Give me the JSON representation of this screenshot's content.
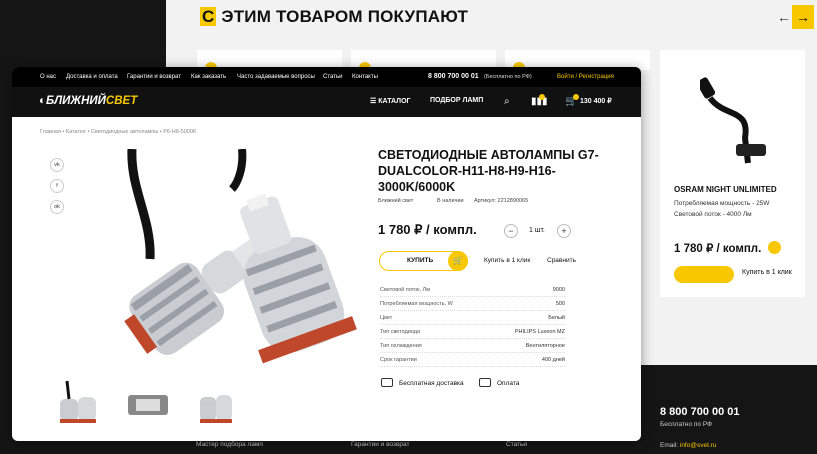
{
  "background": {
    "section_title_hl": "С",
    "section_title_rest": " ЭТИМ ТОВАРОМ ПОКУПАЮТ",
    "arrow_left": "←",
    "arrow_right": "→",
    "side_card": {
      "title": "OSRAM NIGHT UNLIMITED",
      "specs": [
        "Потребляемая мощность - 25W",
        "Световой поток - 4000 Лм"
      ],
      "price": "1 780 ₽ / компл.",
      "one_click": "Купить в 1 клик"
    },
    "footer": {
      "phone": "8 800 700 00 01",
      "free": "Бесплатно по РФ",
      "email_label": "Email: ",
      "email_value": "info@svet.ru",
      "links": [
        "Мастер подбора ламп",
        "Гарантии и возврат",
        "Статьи"
      ]
    }
  },
  "topbar": {
    "nav": [
      "О нас",
      "Доставка и оплата",
      "Гарантии и возврат",
      "Как заказать",
      "Часто задаваемые вопросы",
      "Статьи",
      "Контакты"
    ],
    "phone": "8 800 700 00 01",
    "free": "(Бесплатно по РФ)",
    "login": "Войти / Регистрация"
  },
  "header": {
    "logo_a": "БЛИЖНИЙ",
    "logo_b": "СВЕТ",
    "catalog": "☰ КАТАЛОГ",
    "picker": "ПОДБОР ЛАМП",
    "cart_total": "130 400 ₽",
    "compare_count": "2",
    "cart_count": "3"
  },
  "breadcrumbs": "Главная  •  Каталог  •  Светодиодные автолампы  •  P6-H8-5000K",
  "share": [
    "vk",
    "f",
    "ok"
  ],
  "product": {
    "title": "СВЕТОДИОДНЫЕ АВТОЛАМПЫ G7-DUALCOLOR-H11-H8-H9-H16-3000K/6000K",
    "brand": "Ближний свет",
    "stock": "В наличии",
    "article": "Артикул: 2212890065",
    "price": "1 780 ₽ / компл.",
    "qty": "1 шт.",
    "minus": "−",
    "plus": "+",
    "buy": "КУПИТЬ",
    "one_click": "Купить в 1 клик",
    "compare": "Сравнить",
    "specs": [
      {
        "k": "Световой поток, Лм",
        "v": "9000"
      },
      {
        "k": "Потребляемая мощность, W",
        "v": "500"
      },
      {
        "k": "Цвет",
        "v": "Белый"
      },
      {
        "k": "Тип светодиода",
        "v": "PHILIPS Luxeon MZ"
      },
      {
        "k": "Тип охлаждения",
        "v": "Вентиляторное"
      },
      {
        "k": "Срок гарантии",
        "v": "400 дней"
      }
    ],
    "features": [
      "Бесплатная доставка",
      "Оплата"
    ]
  },
  "colors": {
    "accent": "#f7c800",
    "dark": "#111111"
  }
}
